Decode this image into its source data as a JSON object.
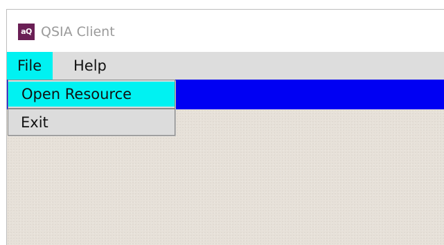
{
  "window": {
    "title": "QSIA Client",
    "icon_text": "aQ",
    "icon_color": "#6a1f55"
  },
  "menubar": {
    "items": [
      {
        "label": "File",
        "active": true
      },
      {
        "label": "Help",
        "active": false
      }
    ]
  },
  "file_menu": {
    "items": [
      {
        "label": "Open Resource",
        "highlighted": true
      },
      {
        "label": "Exit",
        "highlighted": false
      }
    ]
  },
  "colors": {
    "highlight": "#00f2f2",
    "blue_bar": "#0000f3",
    "menubar_bg": "#dddddd",
    "content_bg": "#e7e1d9"
  }
}
